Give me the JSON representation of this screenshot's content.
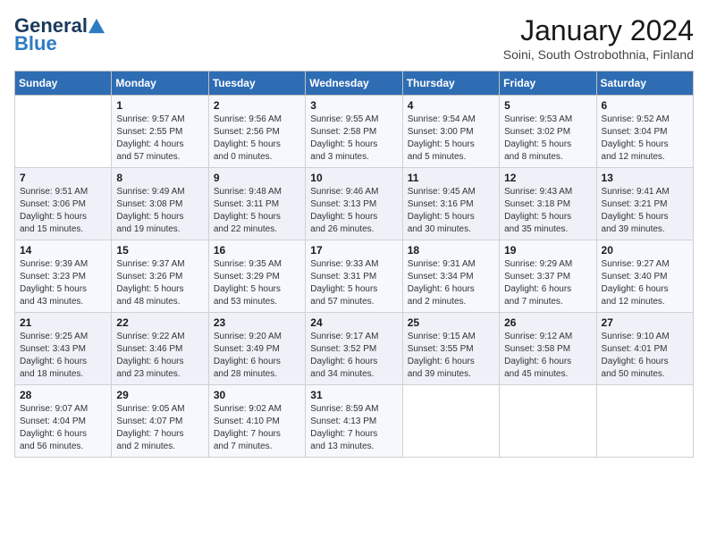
{
  "logo": {
    "general": "General",
    "blue": "Blue"
  },
  "header": {
    "title": "January 2024",
    "subtitle": "Soini, South Ostrobothnia, Finland"
  },
  "weekdays": [
    "Sunday",
    "Monday",
    "Tuesday",
    "Wednesday",
    "Thursday",
    "Friday",
    "Saturday"
  ],
  "weeks": [
    [
      {
        "day": "",
        "info": ""
      },
      {
        "day": "1",
        "info": "Sunrise: 9:57 AM\nSunset: 2:55 PM\nDaylight: 4 hours\nand 57 minutes."
      },
      {
        "day": "2",
        "info": "Sunrise: 9:56 AM\nSunset: 2:56 PM\nDaylight: 5 hours\nand 0 minutes."
      },
      {
        "day": "3",
        "info": "Sunrise: 9:55 AM\nSunset: 2:58 PM\nDaylight: 5 hours\nand 3 minutes."
      },
      {
        "day": "4",
        "info": "Sunrise: 9:54 AM\nSunset: 3:00 PM\nDaylight: 5 hours\nand 5 minutes."
      },
      {
        "day": "5",
        "info": "Sunrise: 9:53 AM\nSunset: 3:02 PM\nDaylight: 5 hours\nand 8 minutes."
      },
      {
        "day": "6",
        "info": "Sunrise: 9:52 AM\nSunset: 3:04 PM\nDaylight: 5 hours\nand 12 minutes."
      }
    ],
    [
      {
        "day": "7",
        "info": "Sunrise: 9:51 AM\nSunset: 3:06 PM\nDaylight: 5 hours\nand 15 minutes."
      },
      {
        "day": "8",
        "info": "Sunrise: 9:49 AM\nSunset: 3:08 PM\nDaylight: 5 hours\nand 19 minutes."
      },
      {
        "day": "9",
        "info": "Sunrise: 9:48 AM\nSunset: 3:11 PM\nDaylight: 5 hours\nand 22 minutes."
      },
      {
        "day": "10",
        "info": "Sunrise: 9:46 AM\nSunset: 3:13 PM\nDaylight: 5 hours\nand 26 minutes."
      },
      {
        "day": "11",
        "info": "Sunrise: 9:45 AM\nSunset: 3:16 PM\nDaylight: 5 hours\nand 30 minutes."
      },
      {
        "day": "12",
        "info": "Sunrise: 9:43 AM\nSunset: 3:18 PM\nDaylight: 5 hours\nand 35 minutes."
      },
      {
        "day": "13",
        "info": "Sunrise: 9:41 AM\nSunset: 3:21 PM\nDaylight: 5 hours\nand 39 minutes."
      }
    ],
    [
      {
        "day": "14",
        "info": "Sunrise: 9:39 AM\nSunset: 3:23 PM\nDaylight: 5 hours\nand 43 minutes."
      },
      {
        "day": "15",
        "info": "Sunrise: 9:37 AM\nSunset: 3:26 PM\nDaylight: 5 hours\nand 48 minutes."
      },
      {
        "day": "16",
        "info": "Sunrise: 9:35 AM\nSunset: 3:29 PM\nDaylight: 5 hours\nand 53 minutes."
      },
      {
        "day": "17",
        "info": "Sunrise: 9:33 AM\nSunset: 3:31 PM\nDaylight: 5 hours\nand 57 minutes."
      },
      {
        "day": "18",
        "info": "Sunrise: 9:31 AM\nSunset: 3:34 PM\nDaylight: 6 hours\nand 2 minutes."
      },
      {
        "day": "19",
        "info": "Sunrise: 9:29 AM\nSunset: 3:37 PM\nDaylight: 6 hours\nand 7 minutes."
      },
      {
        "day": "20",
        "info": "Sunrise: 9:27 AM\nSunset: 3:40 PM\nDaylight: 6 hours\nand 12 minutes."
      }
    ],
    [
      {
        "day": "21",
        "info": "Sunrise: 9:25 AM\nSunset: 3:43 PM\nDaylight: 6 hours\nand 18 minutes."
      },
      {
        "day": "22",
        "info": "Sunrise: 9:22 AM\nSunset: 3:46 PM\nDaylight: 6 hours\nand 23 minutes."
      },
      {
        "day": "23",
        "info": "Sunrise: 9:20 AM\nSunset: 3:49 PM\nDaylight: 6 hours\nand 28 minutes."
      },
      {
        "day": "24",
        "info": "Sunrise: 9:17 AM\nSunset: 3:52 PM\nDaylight: 6 hours\nand 34 minutes."
      },
      {
        "day": "25",
        "info": "Sunrise: 9:15 AM\nSunset: 3:55 PM\nDaylight: 6 hours\nand 39 minutes."
      },
      {
        "day": "26",
        "info": "Sunrise: 9:12 AM\nSunset: 3:58 PM\nDaylight: 6 hours\nand 45 minutes."
      },
      {
        "day": "27",
        "info": "Sunrise: 9:10 AM\nSunset: 4:01 PM\nDaylight: 6 hours\nand 50 minutes."
      }
    ],
    [
      {
        "day": "28",
        "info": "Sunrise: 9:07 AM\nSunset: 4:04 PM\nDaylight: 6 hours\nand 56 minutes."
      },
      {
        "day": "29",
        "info": "Sunrise: 9:05 AM\nSunset: 4:07 PM\nDaylight: 7 hours\nand 2 minutes."
      },
      {
        "day": "30",
        "info": "Sunrise: 9:02 AM\nSunset: 4:10 PM\nDaylight: 7 hours\nand 7 minutes."
      },
      {
        "day": "31",
        "info": "Sunrise: 8:59 AM\nSunset: 4:13 PM\nDaylight: 7 hours\nand 13 minutes."
      },
      {
        "day": "",
        "info": ""
      },
      {
        "day": "",
        "info": ""
      },
      {
        "day": "",
        "info": ""
      }
    ]
  ]
}
